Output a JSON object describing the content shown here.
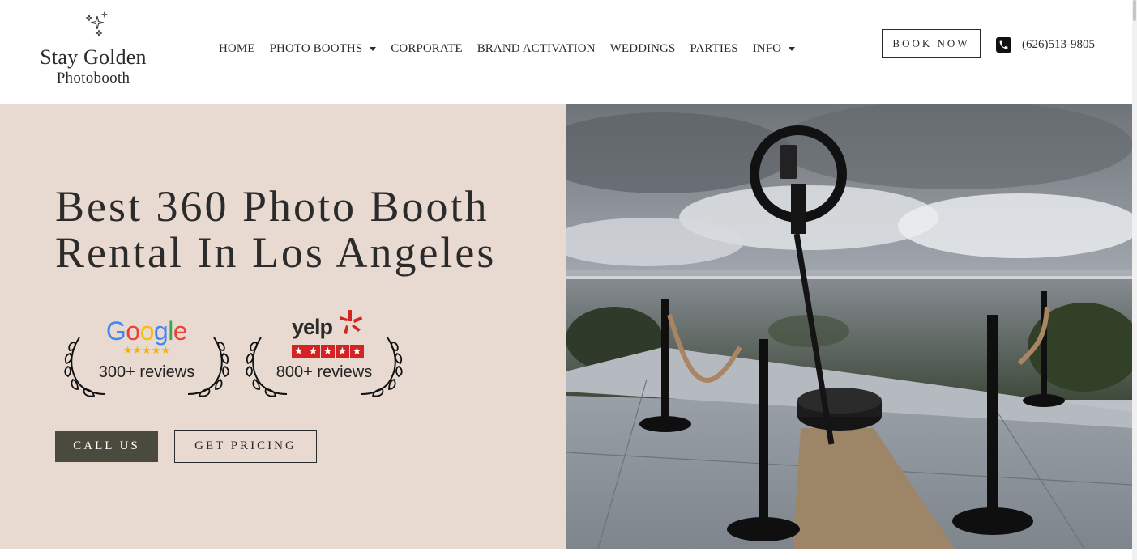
{
  "brand": {
    "name": "Stay Golden",
    "sub": "Photobooth"
  },
  "nav": {
    "items": [
      {
        "label": "HOME",
        "dropdown": false
      },
      {
        "label": "PHOTO BOOTHS",
        "dropdown": true
      },
      {
        "label": "CORPORATE",
        "dropdown": false
      },
      {
        "label": "BRAND ACTIVATION",
        "dropdown": false
      },
      {
        "label": "WEDDINGS",
        "dropdown": false
      },
      {
        "label": "PARTIES",
        "dropdown": false
      },
      {
        "label": "INFO",
        "dropdown": true
      }
    ]
  },
  "header": {
    "book_label": "BOOK NOW",
    "phone": "(626)513-9805"
  },
  "hero": {
    "headline_line1": "Best 360 Photo Booth",
    "headline_line2": "Rental In Los Angeles",
    "google_reviews": "300+ reviews",
    "yelp_reviews": "800+ reviews",
    "call_label": "CALL US",
    "pricing_label": "GET PRICING"
  },
  "badges": {
    "google_logo": "Google",
    "yelp_logo": "yelp",
    "google_stars": 5,
    "yelp_stars": 5
  },
  "colors": {
    "hero_bg": "#e8d9d1",
    "call_button_bg": "#4b4a3e",
    "text": "#2b2b2b",
    "yelp_red": "#d32323",
    "google_star": "#f4b400"
  }
}
